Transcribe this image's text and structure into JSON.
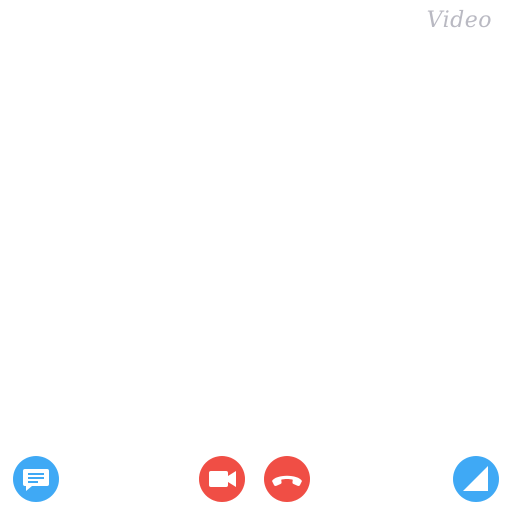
{
  "app": {
    "brand_title": "Video"
  },
  "colors": {
    "chat": "#3fa9f5",
    "video": "#f04e45",
    "hangup": "#f04e45",
    "fullscreen": "#3fa9f5",
    "brand": "#b9b9c2"
  },
  "controls": {
    "chat_icon": "chat-bubble-icon",
    "video_icon": "video-camera-icon",
    "hangup_icon": "phone-hangup-icon",
    "fullscreen_icon": "resize-corner-icon"
  }
}
